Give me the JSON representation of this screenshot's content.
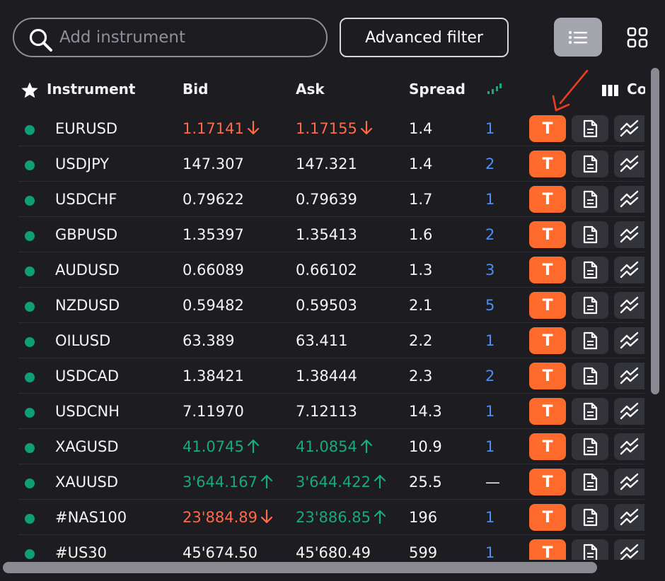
{
  "search": {
    "placeholder": "Add instrument",
    "value": ""
  },
  "toolbar": {
    "advanced_filter_label": "Advanced filter"
  },
  "header": {
    "instrument": "Instrument",
    "bid": "Bid",
    "ask": "Ask",
    "spread": "Spread",
    "columns": "Co"
  },
  "colors": {
    "up": "#18a97c",
    "down": "#ff6b4a",
    "accent": "#ff6b2c",
    "level": "#4f8ff0",
    "online": "#0e9f74"
  },
  "trade_button_label": "T",
  "rows": [
    {
      "name": "EURUSD",
      "bid": "1.17141",
      "ask": "1.17155",
      "spread": "1.4",
      "level": "1",
      "trend": "down"
    },
    {
      "name": "USDJPY",
      "bid": "147.307",
      "ask": "147.321",
      "spread": "1.4",
      "level": "2",
      "trend": "none"
    },
    {
      "name": "USDCHF",
      "bid": "0.79622",
      "ask": "0.79639",
      "spread": "1.7",
      "level": "1",
      "trend": "none"
    },
    {
      "name": "GBPUSD",
      "bid": "1.35397",
      "ask": "1.35413",
      "spread": "1.6",
      "level": "2",
      "trend": "none"
    },
    {
      "name": "AUDUSD",
      "bid": "0.66089",
      "ask": "0.66102",
      "spread": "1.3",
      "level": "3",
      "trend": "none"
    },
    {
      "name": "NZDUSD",
      "bid": "0.59482",
      "ask": "0.59503",
      "spread": "2.1",
      "level": "5",
      "trend": "none"
    },
    {
      "name": "OILUSD",
      "bid": "63.389",
      "ask": "63.411",
      "spread": "2.2",
      "level": "1",
      "trend": "none"
    },
    {
      "name": "USDCAD",
      "bid": "1.38421",
      "ask": "1.38444",
      "spread": "2.3",
      "level": "2",
      "trend": "none"
    },
    {
      "name": "USDCNH",
      "bid": "7.11970",
      "ask": "7.12113",
      "spread": "14.3",
      "level": "1",
      "trend": "none"
    },
    {
      "name": "XAGUSD",
      "bid": "41.0745",
      "ask": "41.0854",
      "spread": "10.9",
      "level": "1",
      "trend": "up"
    },
    {
      "name": "XAUUSD",
      "bid": "3'644.167",
      "ask": "3'644.422",
      "spread": "25.5",
      "level": "—",
      "trend": "up"
    },
    {
      "name": "#NAS100",
      "bid": "23'884.89",
      "ask": "23'886.85",
      "spread": "196",
      "level": "1",
      "trend": "mixed"
    },
    {
      "name": "#US30",
      "bid": "45'674.50",
      "ask": "45'680.49",
      "spread": "599",
      "level": "1",
      "trend": "none"
    }
  ]
}
